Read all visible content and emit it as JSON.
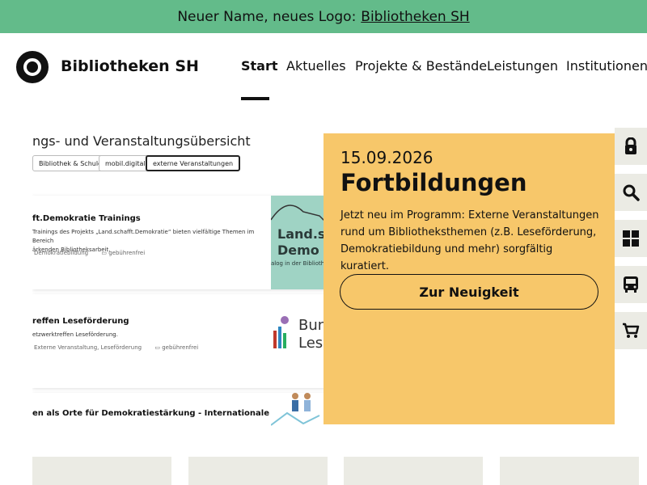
{
  "banner": {
    "text": "Neuer Name, neues Logo:",
    "link": "Bibliotheken SH"
  },
  "brand": {
    "name": "Bibliotheken SH"
  },
  "nav": {
    "items": [
      "Start",
      "Aktuelles",
      "Projekte & Bestände",
      "Leistungen",
      "Institutionen"
    ],
    "active": "Start"
  },
  "screenshot": {
    "title": "ngs- und Veranstaltungsübersicht",
    "filters": [
      "Bibliothek & Schule",
      "mobil.digital",
      "externe Veranstaltungen"
    ],
    "selected_filter": "externe Veranstaltungen",
    "cards": [
      {
        "title": "ft.Demokratie Trainings",
        "text1": "Trainings des Projekts „Land.schafft.Demokratie“ bieten vielfältige Themen im Bereich",
        "text2": "ärkenden Bibliotheksarbeit.",
        "tag": "Demokratiebildung",
        "fee": "gebührenfrei",
        "thumb_line1": "Land.s",
        "thumb_line2": "Demo",
        "thumb_line3": "alog in der Biblioth"
      },
      {
        "title": "reffen Leseförderung",
        "text1": "etzwerktreffen Leseförderung.",
        "tag": "Externe Veranstaltung, Leseförderung",
        "fee": "gebührenfrei",
        "thumb_line1": "Bun",
        "thumb_line2": "Lese"
      },
      {
        "title": "en als Orte für Demokratiestärkung - Internationale Inspira-"
      }
    ]
  },
  "teaser": {
    "date": "15.09.2026",
    "title": "Fortbildungen",
    "text": "Jetzt neu im Programm: Externe Veranstaltungen rund um Bibliotheksthemen (z.B. Leseförderung, Demokratiebildung und mehr) sorgfältig kuratiert.",
    "button": "Zur Neuigkeit"
  },
  "sidebar": {
    "icons": [
      "lock-icon",
      "search-icon",
      "grid-icon",
      "bus-icon",
      "cart-icon"
    ]
  },
  "colors": {
    "banner": "#63bb8a",
    "teaser": "#f7c76a",
    "tile": "#ebebe4",
    "text": "#111111"
  }
}
